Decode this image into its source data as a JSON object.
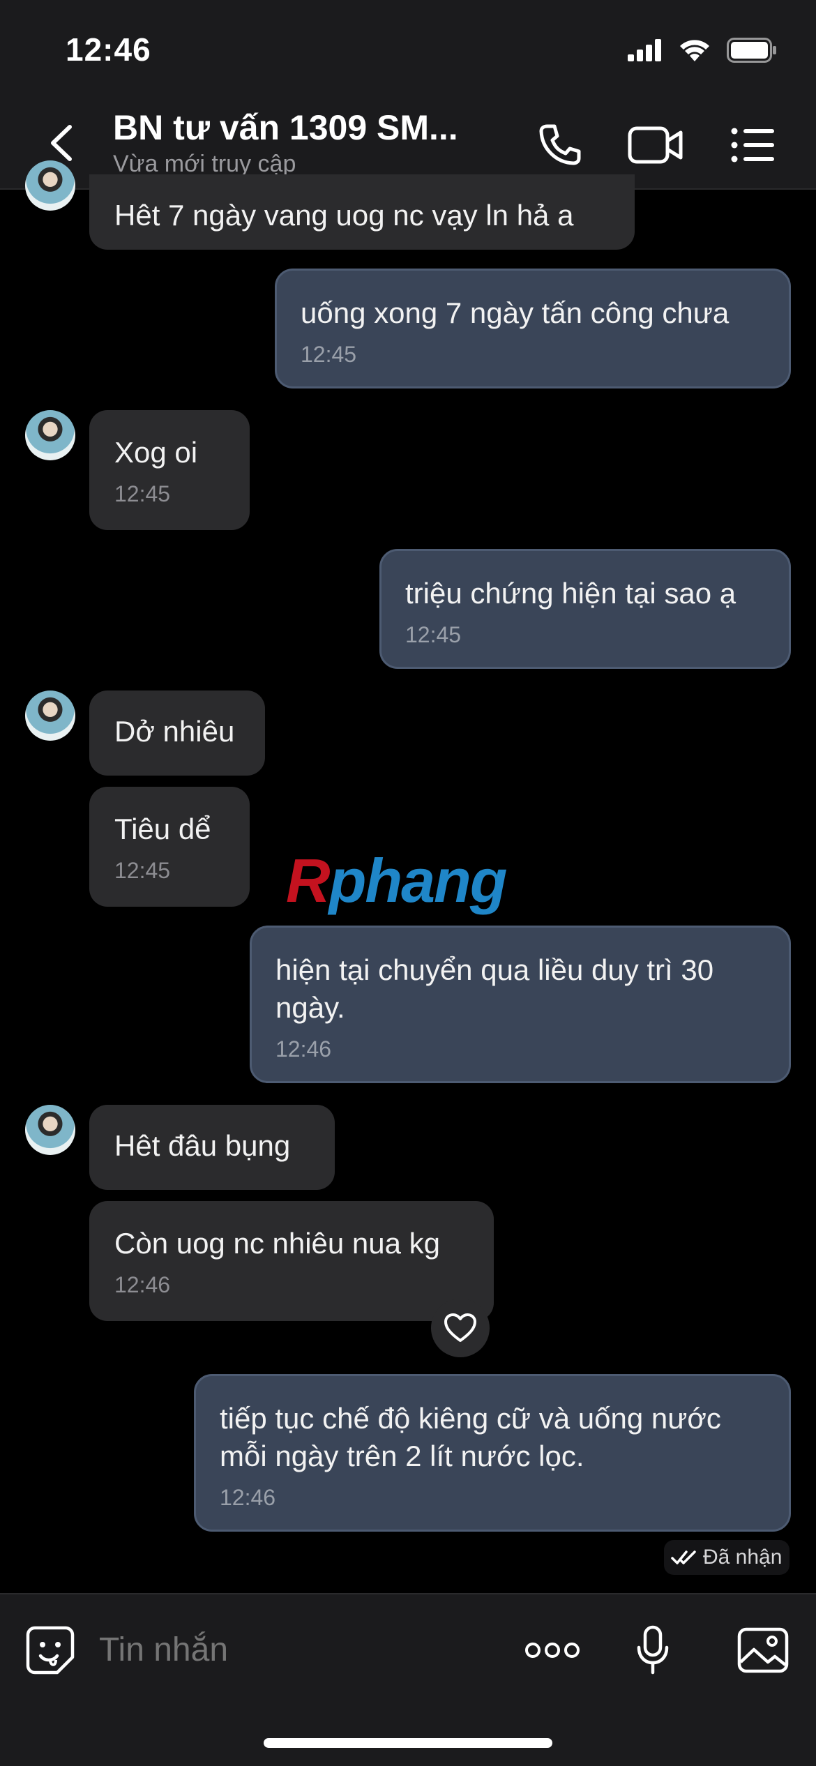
{
  "status_bar": {
    "time": "12:46"
  },
  "header": {
    "title": "BN tư vấn 1309 SM...",
    "subtitle": "Vừa mới truy cập",
    "icons": [
      "back-chevron-icon",
      "phone-icon",
      "video-camera-icon",
      "menu-list-icon"
    ]
  },
  "messages": [
    {
      "dir": "in",
      "text": "Hêt 7 ngày vang uog nc vạy ln hả a",
      "time": ""
    },
    {
      "dir": "out",
      "text": "uống xong 7 ngày tấn công chưa",
      "time": "12:45"
    },
    {
      "dir": "in",
      "text": "Xog oi",
      "time": "12:45"
    },
    {
      "dir": "out",
      "text": "triệu chứng hiện tại sao ạ",
      "time": "12:45"
    },
    {
      "dir": "in",
      "text": "Dở nhiêu",
      "time": ""
    },
    {
      "dir": "in",
      "text": "Tiêu dể",
      "time": "12:45"
    },
    {
      "dir": "out",
      "text": "hiện tại chuyển qua liều duy trì 30 ngày.",
      "time": "12:46"
    },
    {
      "dir": "in",
      "text": "Hêt đâu bụng",
      "time": ""
    },
    {
      "dir": "in",
      "text": "Còn uog nc nhiêu nua kg",
      "time": "12:46"
    },
    {
      "dir": "out",
      "text": "tiếp tục chế độ kiêng cữ và uống nước mỗi ngày trên  2 lít nước lọc.",
      "time": "12:46"
    }
  ],
  "watermark": {
    "part1": "R",
    "part2": "phang"
  },
  "received_label": "Đã nhận",
  "input": {
    "placeholder": "Tin nhắn"
  },
  "colors": {
    "incoming": "#2b2b2d",
    "outgoing": "#3a4558",
    "background": "#000000"
  }
}
